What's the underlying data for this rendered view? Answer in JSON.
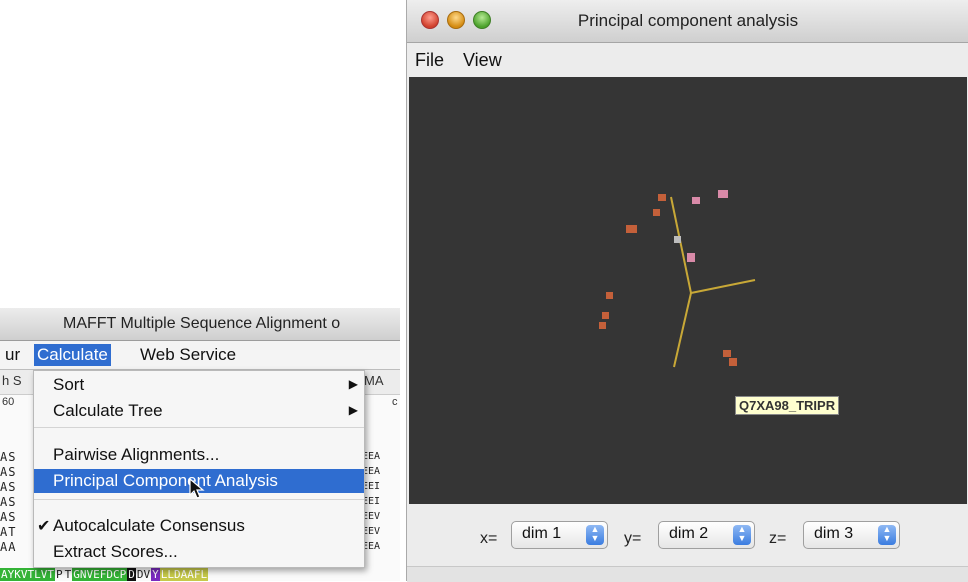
{
  "jalview": {
    "title": "MAFFT Multiple Sequence Alignment o",
    "menus": {
      "prev_fragment": "ur",
      "calculate": "Calculate",
      "web_service": "Web Service"
    },
    "toolrow": {
      "left_fragment": "h S",
      "right_fragment": "MA"
    },
    "ruler": {
      "left": "60",
      "right": "c"
    },
    "seq_left": [
      "AS",
      "AS",
      "AS",
      "AS",
      "AS",
      "AT",
      "AA"
    ],
    "seq_right": [
      "EEA",
      "EEA",
      "EEI",
      "EEI",
      "EEV",
      "EEV",
      "EEA"
    ],
    "bottom_sequence": [
      {
        "text": "AYKVTLVT",
        "color": "#34b336",
        "fg": "#ffffff"
      },
      {
        "text": "P",
        "color": "#fafafa",
        "fg": "#222222"
      },
      {
        "text": "T",
        "color": "#fafafa",
        "fg": "#222222"
      },
      {
        "text": "GNVEFDCP",
        "color": "#34b336",
        "fg": "#ffffff"
      },
      {
        "text": "D",
        "color": "#111111",
        "fg": "#ffffff"
      },
      {
        "text": "DV",
        "color": "#fafafa",
        "fg": "#222222"
      },
      {
        "text": "Y",
        "color": "#7a2bbf",
        "fg": "#ffffff"
      },
      {
        "text": "LLDAAFL",
        "color": "#c6c94a",
        "fg": "#ffffff"
      }
    ]
  },
  "calculate_menu": {
    "items": [
      {
        "label": "Sort",
        "submenu": true,
        "checked": false
      },
      {
        "label": "Calculate Tree",
        "submenu": true,
        "checked": false
      },
      {
        "label": "Pairwise Alignments...",
        "submenu": false,
        "checked": false
      },
      {
        "label": "Principal Component Analysis",
        "submenu": false,
        "checked": false,
        "selected": true
      },
      {
        "label": "Autocalculate Consensus",
        "submenu": false,
        "checked": true
      },
      {
        "label": "Extract Scores...",
        "submenu": false,
        "checked": false
      }
    ]
  },
  "pca": {
    "title": "Principal component analysis",
    "menus": {
      "file": "File",
      "view": "View"
    },
    "tooltip": "Q7XA98_TRIPR",
    "controls": {
      "x_label": "x=",
      "y_label": "y=",
      "z_label": "z=",
      "x_value": "dim 1",
      "y_value": "dim 2",
      "z_value": "dim 3"
    },
    "colors": {
      "background": "#353535",
      "axes": "#c8a837",
      "point_main": "#c4603a",
      "point_pink": "#d98aa8",
      "point_grey": "#bdbdbd"
    }
  }
}
